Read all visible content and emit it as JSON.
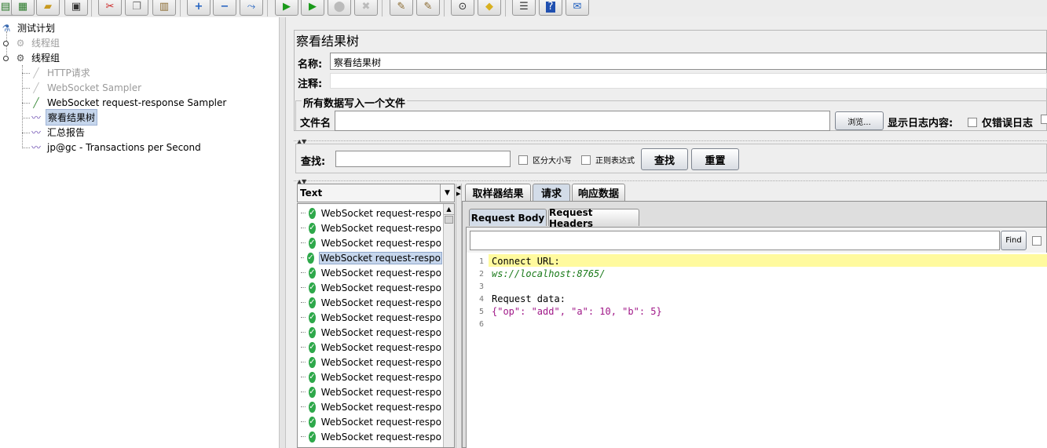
{
  "toolbar": {
    "icons": [
      "new-template-icon",
      "templates-icon",
      "open-icon",
      "save-icon",
      "cut-icon",
      "copy-icon",
      "paste-icon",
      "expand-icon",
      "collapse-icon",
      "toggle-icon",
      "start-icon",
      "start-no-pause-icon",
      "stop-icon",
      "shutdown-icon",
      "clear-icon",
      "clear-all-icon",
      "search-icon",
      "reset-search-icon",
      "function-helper-icon",
      "help-icon",
      "remote-icon"
    ]
  },
  "tree": {
    "items": [
      {
        "label": "测试计划",
        "icon": "test-plan-icon",
        "enabled": true
      },
      {
        "label": "线程组",
        "icon": "thread-group-icon",
        "enabled": false
      },
      {
        "label": "线程组",
        "icon": "thread-group-icon",
        "enabled": true
      },
      {
        "label": "HTTP请求",
        "icon": "sampler-icon",
        "enabled": false
      },
      {
        "label": "WebSocket Sampler",
        "icon": "sampler-icon",
        "enabled": false
      },
      {
        "label": "WebSocket request-response Sampler",
        "icon": "sampler-icon",
        "enabled": true
      },
      {
        "label": "察看结果树",
        "icon": "listener-icon",
        "enabled": true,
        "selected": true
      },
      {
        "label": "汇总报告",
        "icon": "listener-icon",
        "enabled": true
      },
      {
        "label": "jp@gc - Transactions per Second",
        "icon": "listener-icon",
        "enabled": true
      }
    ]
  },
  "panel": {
    "title": "察看结果树",
    "name_label": "名称:",
    "name_value": "察看结果树",
    "comment_label": "注释:",
    "comment_value": "",
    "file_section_title": "所有数据写入一个文件",
    "filename_label": "文件名",
    "filename_value": "",
    "browse_label": "浏览...",
    "log_content_label": "显示日志内容:",
    "errors_only_label": "仅错误日志"
  },
  "search": {
    "label": "查找:",
    "value": "",
    "case_label": "区分大小写",
    "regex_label": "正则表达式",
    "find_label": "查找",
    "reset_label": "重置"
  },
  "results": {
    "renderer": "Text",
    "item_label": "WebSocket request-respo",
    "item_count": 16,
    "selected_index": 3
  },
  "tabs": {
    "main": [
      "取样器结果",
      "请求",
      "响应数据"
    ],
    "main_active": 1,
    "sub": [
      "Request Body",
      "Request Headers"
    ],
    "sub_active": 0
  },
  "viewer": {
    "find_label": "Find",
    "search_value": "",
    "lines": [
      {
        "num": "1",
        "text": "Connect URL:"
      },
      {
        "num": "2",
        "text": "ws://localhost:8765/"
      },
      {
        "num": "3",
        "text": ""
      },
      {
        "num": "4",
        "text": "Request data:"
      },
      {
        "num": "5",
        "text": "{\"op\": \"add\", \"a\": 10, \"b\": 5}"
      },
      {
        "num": "6",
        "text": ""
      }
    ]
  }
}
